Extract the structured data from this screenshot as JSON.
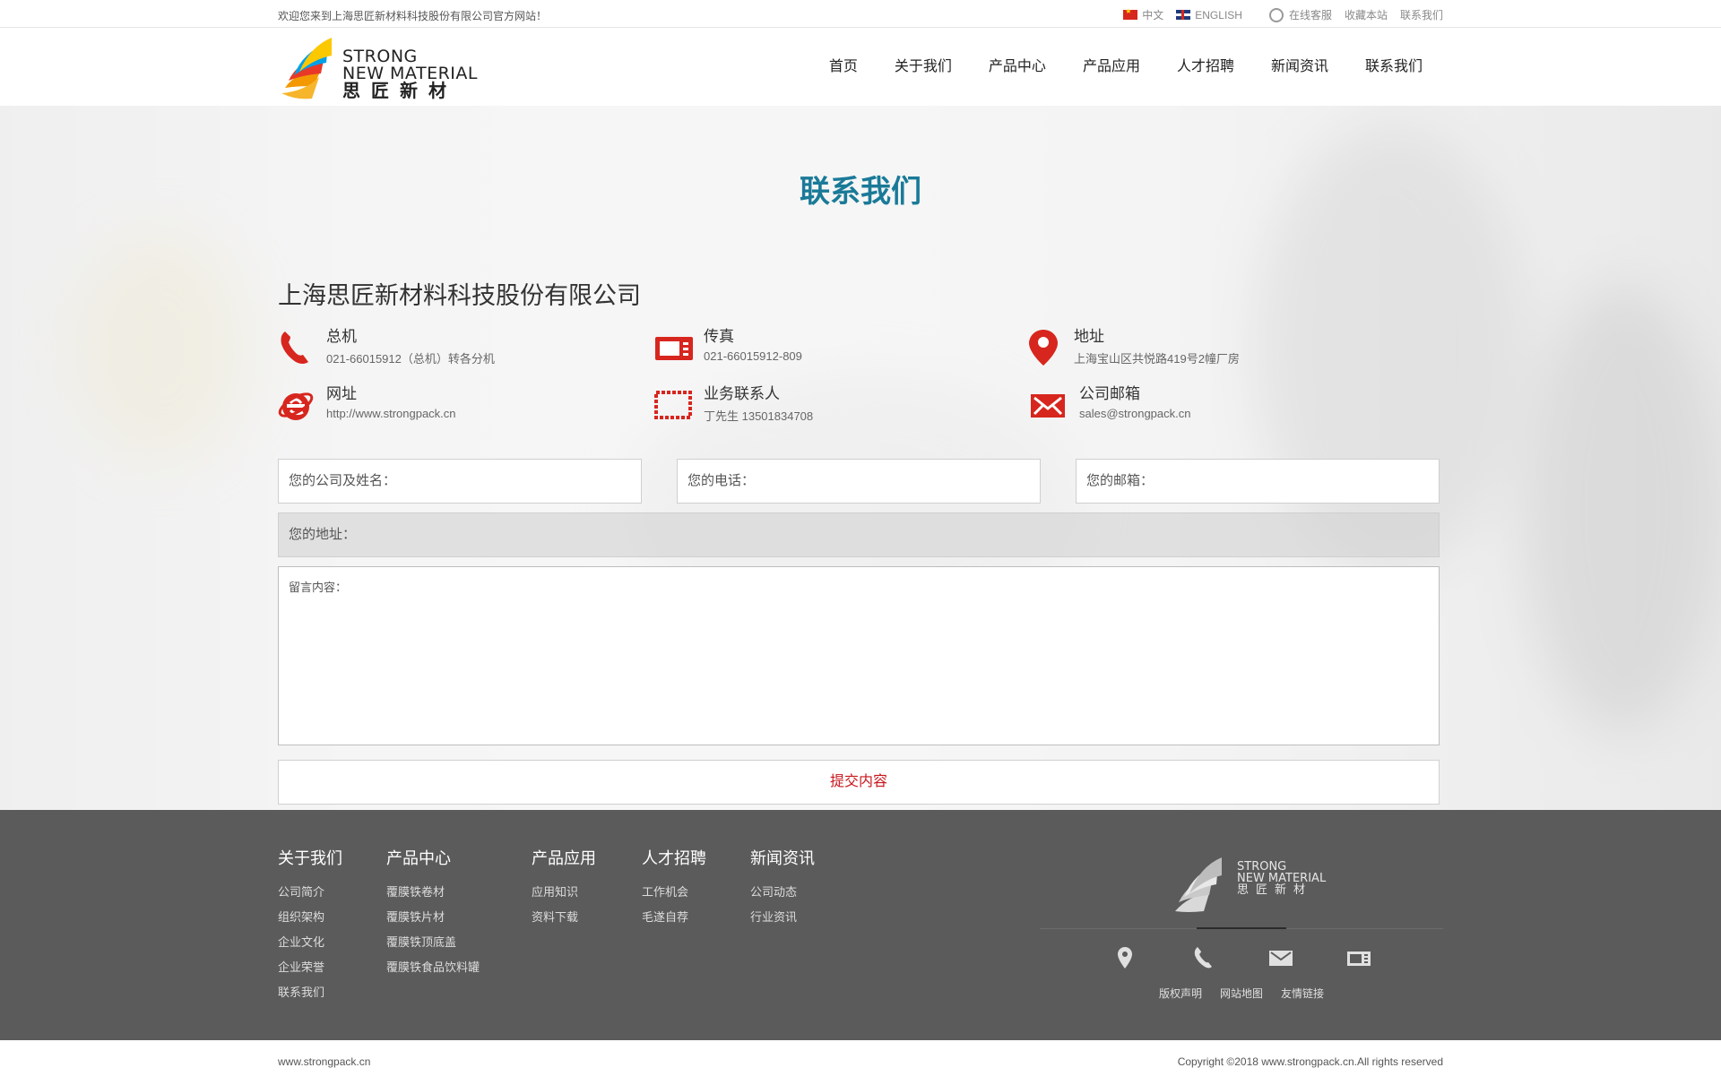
{
  "topbar": {
    "welcome": "欢迎您来到上海思匠新材料科技股份有限公司官方网站！",
    "lang_cn": "中文",
    "lang_en": "ENGLISH",
    "service": "在线客服",
    "bookmark": "收藏本站",
    "contact": "联系我们"
  },
  "logo": {
    "line1": "STRONG",
    "line2": "NEW MATERIAL",
    "line3": "思匠新材"
  },
  "nav": [
    "首页",
    "关于我们",
    "产品中心",
    "产品应用",
    "人才招聘",
    "新闻资讯",
    "联系我们"
  ],
  "page_title": "联系我们",
  "company": "上海思匠新材料科技股份有限公司",
  "info": {
    "phone": {
      "label": "总机",
      "value": "021-66015912（总机）转各分机",
      "icon": "phone-icon"
    },
    "fax": {
      "label": "传真",
      "value": "021-66015912-809",
      "icon": "fax-icon"
    },
    "address": {
      "label": "地址",
      "value": "上海宝山区共悦路419号2幢厂房",
      "icon": "location-pin-icon"
    },
    "website": {
      "label": "网址",
      "value": "http://www.strongpack.cn",
      "icon": "browser-e-icon"
    },
    "contact": {
      "label": "业务联系人",
      "value": "丁先生 13501834708",
      "icon": "stamp-icon"
    },
    "email": {
      "label": "公司邮箱",
      "value": "sales@strongpack.cn",
      "icon": "envelope-icon"
    }
  },
  "form": {
    "name": "您的公司及姓名：",
    "phone": "您的电话：",
    "email": "您的邮箱：",
    "address": "您的地址：",
    "message": "留言内容：",
    "submit": "提交内容"
  },
  "footer": {
    "cols": [
      {
        "title": "关于我们",
        "items": [
          "公司简介",
          "组织架构",
          "企业文化",
          "企业荣誉",
          "联系我们"
        ]
      },
      {
        "title": "产品中心",
        "items": [
          "覆膜铁卷材",
          "覆膜铁片材",
          "覆膜铁顶底盖",
          "覆膜铁食品饮料罐"
        ]
      },
      {
        "title": "产品应用",
        "items": [
          "应用知识",
          "资料下载"
        ]
      },
      {
        "title": "人才招聘",
        "items": [
          "工作机会",
          "毛遂自荐"
        ]
      },
      {
        "title": "新闻资讯",
        "items": [
          "公司动态",
          "行业资讯"
        ]
      }
    ],
    "logo": {
      "line1": "STRONG",
      "line2": "NEW MATERIAL",
      "line3": "思匠新材"
    },
    "links": [
      "版权声明",
      "网站地图",
      "友情链接"
    ]
  },
  "bottom": {
    "left": "www.strongpack.cn",
    "right": "Copyright ©2018 www.strongpack.cn.All rights reserved"
  },
  "colors": {
    "accent": "#1a7a98",
    "red": "#c9161c",
    "footer_bg": "#5b5b5b"
  }
}
